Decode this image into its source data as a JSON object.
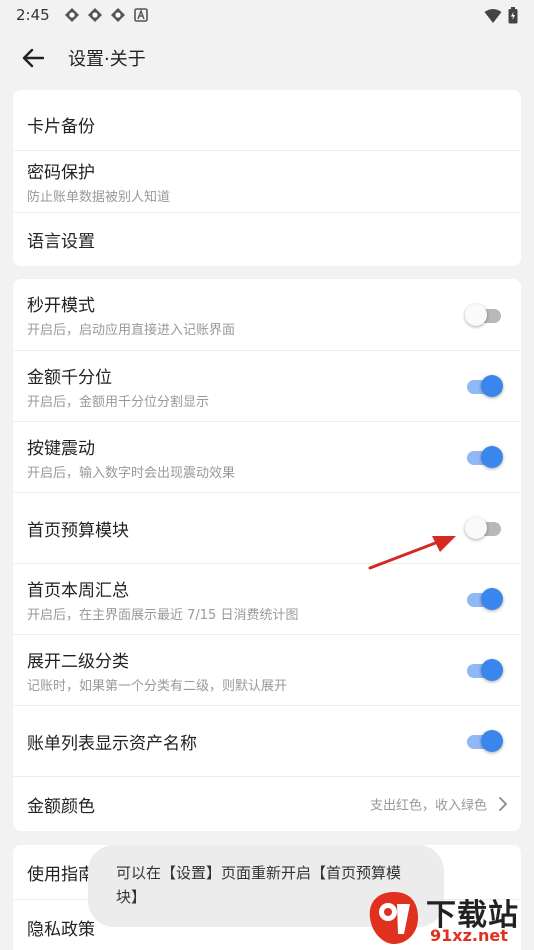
{
  "status": {
    "time": "2:45"
  },
  "header": {
    "title": "设置·关于"
  },
  "group1": [
    {
      "title": "卡片备份"
    },
    {
      "title": "密码保护",
      "subtitle": "防止账单数据被别人知道"
    },
    {
      "title": "语言设置"
    }
  ],
  "group2": [
    {
      "title": "秒开模式",
      "subtitle": "开启后，启动应用直接进入记账界面",
      "toggle": false
    },
    {
      "title": "金额千分位",
      "subtitle": "开启后，金额用千分位分割显示",
      "toggle": true
    },
    {
      "title": "按键震动",
      "subtitle": "开启后，输入数字时会出现震动效果",
      "toggle": true
    },
    {
      "title": "首页预算模块",
      "toggle": false
    },
    {
      "title": "首页本周汇总",
      "subtitle": "开启后，在主界面展示最近 7/15 日消费统计图",
      "toggle": true
    },
    {
      "title": "展开二级分类",
      "subtitle": "记账时，如果第一个分类有二级，则默认展开",
      "toggle": true
    },
    {
      "title": "账单列表显示资产名称",
      "toggle": true
    },
    {
      "title": "金额颜色",
      "value": "支出红色，收入绿色"
    }
  ],
  "group3": [
    {
      "title": "使用指南"
    },
    {
      "title": "隐私政策"
    }
  ],
  "toast": {
    "text": "可以在【设置】页面重新开启【首页预算模块】"
  },
  "watermark": {
    "text": "下载站",
    "domain": "91xz.net"
  },
  "colors": {
    "accent": "#3a86ec",
    "annotation": "#d42a22"
  }
}
